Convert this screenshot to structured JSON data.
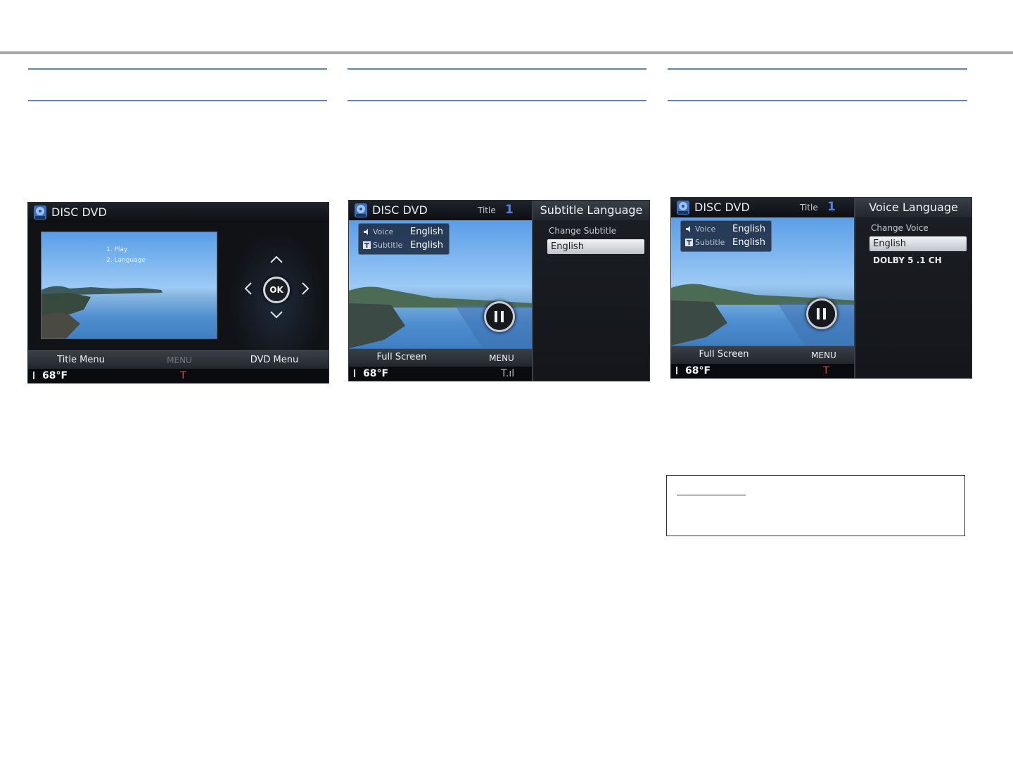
{
  "screens": {
    "dvd_menu": {
      "source": "DISC DVD",
      "menu_items": [
        "1. Play",
        "2. Language"
      ],
      "ok_label": "OK",
      "buttons": {
        "left": "Title Menu",
        "center": "MENU",
        "right": "DVD Menu"
      },
      "temperature": "68°F"
    },
    "subtitle": {
      "source": "DISC DVD",
      "title_label": "Title",
      "title_number": "1",
      "osd": {
        "voice_label": "Voice",
        "voice_value": "English",
        "subtitle_label": "Subtitle",
        "subtitle_value": "English"
      },
      "buttons": {
        "left": "Full Screen",
        "center": "MENU"
      },
      "temperature": "68°F",
      "panel": {
        "title": "Subtitle Language",
        "heading": "Change Subtitle",
        "selected": "English"
      }
    },
    "voice": {
      "source": "DISC DVD",
      "title_label": "Title",
      "title_number": "1",
      "osd": {
        "voice_label": "Voice",
        "voice_value": "English",
        "subtitle_label": "Subtitle",
        "subtitle_value": "English"
      },
      "buttons": {
        "left": "Full Screen",
        "center": "MENU"
      },
      "temperature": "68°F",
      "panel": {
        "title": "Voice Language",
        "heading": "Change Voice",
        "selected": "English",
        "other": "DOLBY 5 .1 CH"
      }
    }
  },
  "colors": {
    "rule": "#5f84b8",
    "accent_blue": "#4b83e6"
  },
  "icons": [
    "disc-icon",
    "speaker-icon",
    "subtitle-icon",
    "thermometer-icon",
    "signal-icon",
    "pause-icon",
    "chevron-up-icon",
    "chevron-down-icon",
    "chevron-left-icon",
    "chevron-right-icon"
  ]
}
